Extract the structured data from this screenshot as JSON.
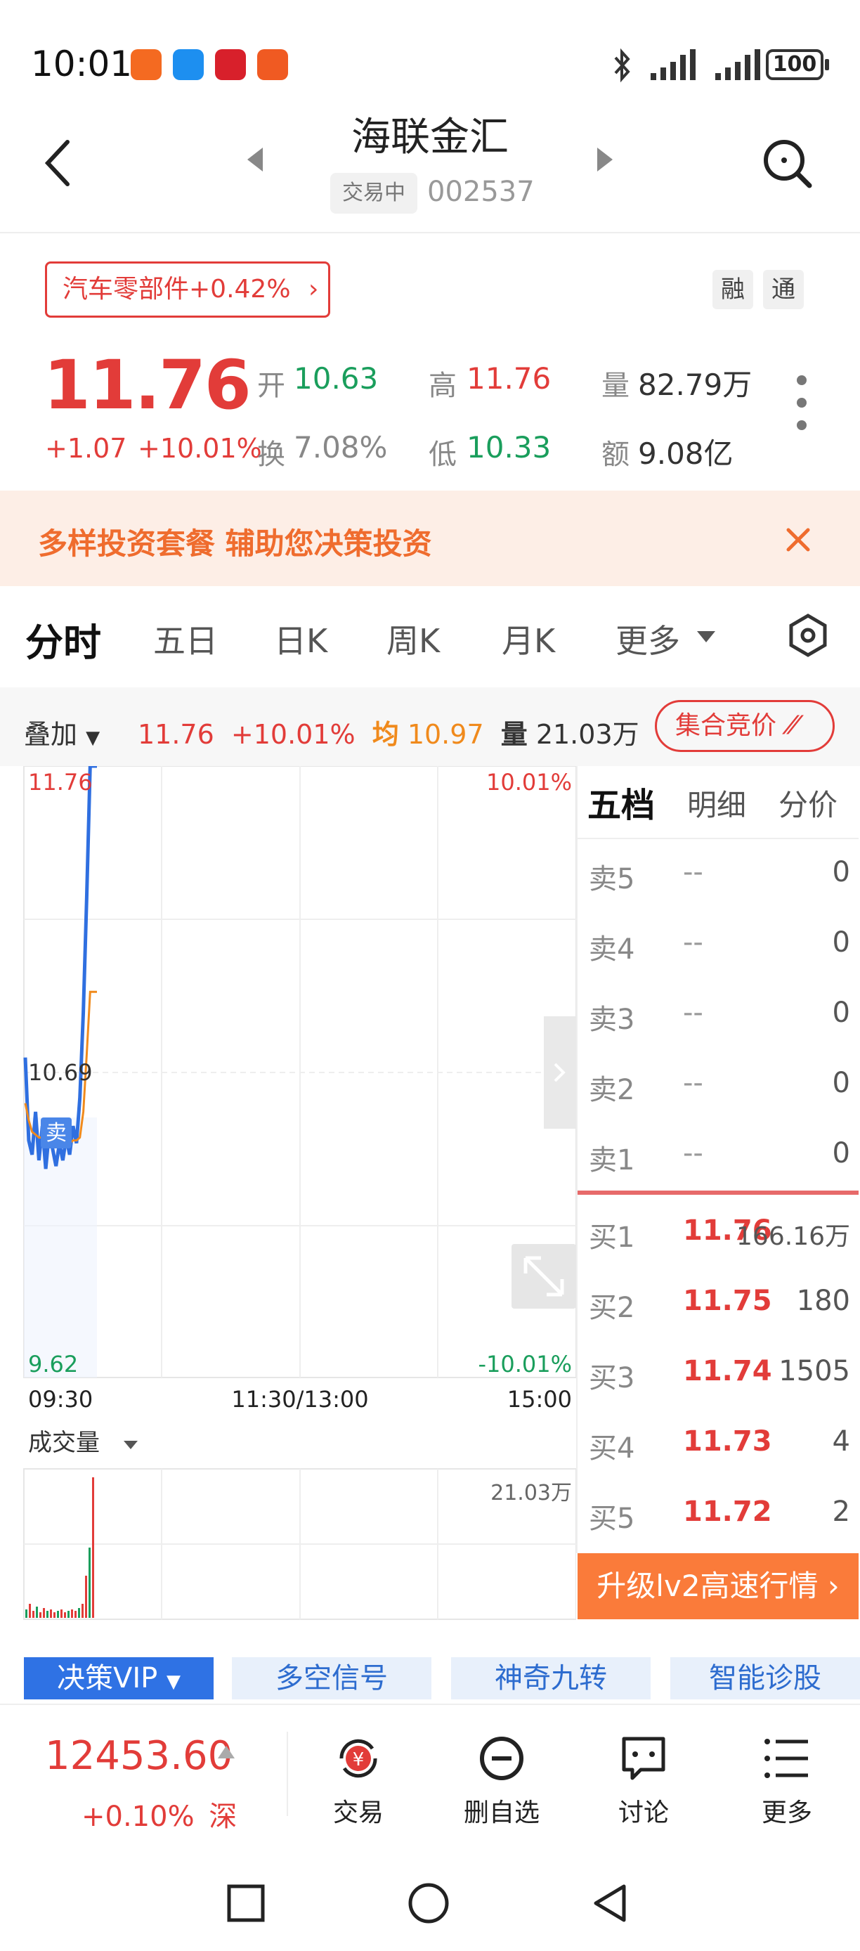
{
  "status_bar": {
    "time": "10:01",
    "battery": "100"
  },
  "header": {
    "title": "海联金汇",
    "trading_status": "交易中",
    "stock_code": "002537"
  },
  "quote": {
    "sector": "汽车零部件+0.42%",
    "tag_margin": "融",
    "tag_connect": "通",
    "price": "11.76",
    "change": "+1.07",
    "change_pct": "+10.01%",
    "open_label": "开",
    "open": "10.63",
    "high_label": "高",
    "high": "11.76",
    "volume_label": "量",
    "volume": "82.79万",
    "turnover_label": "换",
    "turnover": "7.08%",
    "low_label": "低",
    "low": "10.33",
    "amount_label": "额",
    "amount": "9.08亿"
  },
  "promo": {
    "text": "多样投资套餐 辅助您决策投资"
  },
  "tabs": [
    "分时",
    "五日",
    "日K",
    "周K",
    "月K",
    "更多"
  ],
  "overlay_bar": {
    "label": "叠加",
    "price": "11.76",
    "pct": "+10.01%",
    "avg_label": "均",
    "avg": "10.97",
    "vol_label": "量",
    "vol": "21.03万",
    "auction": "集合竞价"
  },
  "chart_data": {
    "type": "line",
    "y_top": "11.76",
    "y_mid": "10.69",
    "y_bottom": "9.62",
    "pct_top": "10.01%",
    "pct_bottom": "-10.01%",
    "x_labels": [
      "09:30",
      "11:30/13:00",
      "15:00"
    ],
    "ylim": [
      9.62,
      11.76
    ],
    "marker": "卖",
    "series": [
      {
        "name": "price",
        "color": "#2f6fe0",
        "values": [
          10.74,
          10.45,
          10.4,
          10.55,
          10.38,
          10.5,
          10.35,
          10.48,
          10.42,
          10.36,
          10.44,
          10.38,
          10.46,
          10.4,
          10.5,
          10.44,
          10.6,
          10.9,
          11.3,
          11.76,
          11.76,
          11.76
        ]
      },
      {
        "name": "average",
        "color": "#f08a1c",
        "values": [
          10.58,
          10.52,
          10.48,
          10.47,
          10.46,
          10.46,
          10.45,
          10.45,
          10.45,
          10.44,
          10.44,
          10.44,
          10.44,
          10.44,
          10.45,
          10.45,
          10.46,
          10.55,
          10.75,
          10.97,
          10.97,
          10.97
        ]
      }
    ],
    "volume_label": "成交量",
    "volume_max": "21.03万"
  },
  "order_book": {
    "tabs": [
      "五档",
      "明细",
      "分价"
    ],
    "asks": [
      {
        "label": "卖5",
        "price": "--",
        "vol": "0"
      },
      {
        "label": "卖4",
        "price": "--",
        "vol": "0"
      },
      {
        "label": "卖3",
        "price": "--",
        "vol": "0"
      },
      {
        "label": "卖2",
        "price": "--",
        "vol": "0"
      },
      {
        "label": "卖1",
        "price": "--",
        "vol": "0"
      }
    ],
    "bids": [
      {
        "label": "买1",
        "price": "11.76",
        "vol": "166.16万"
      },
      {
        "label": "买2",
        "price": "11.75",
        "vol": "180"
      },
      {
        "label": "买3",
        "price": "11.74",
        "vol": "1505"
      },
      {
        "label": "买4",
        "price": "11.73",
        "vol": "4"
      },
      {
        "label": "买5",
        "price": "11.72",
        "vol": "2"
      }
    ],
    "upgrade": "升级lv2高速行情"
  },
  "features": [
    "决策VIP",
    "多空信号",
    "神奇九转",
    "智能诊股"
  ],
  "bottom_bar": {
    "index_value": "12453.60",
    "index_change": "+0.10%",
    "index_market": "深",
    "actions": [
      "交易",
      "删自选",
      "讨论",
      "更多"
    ]
  }
}
